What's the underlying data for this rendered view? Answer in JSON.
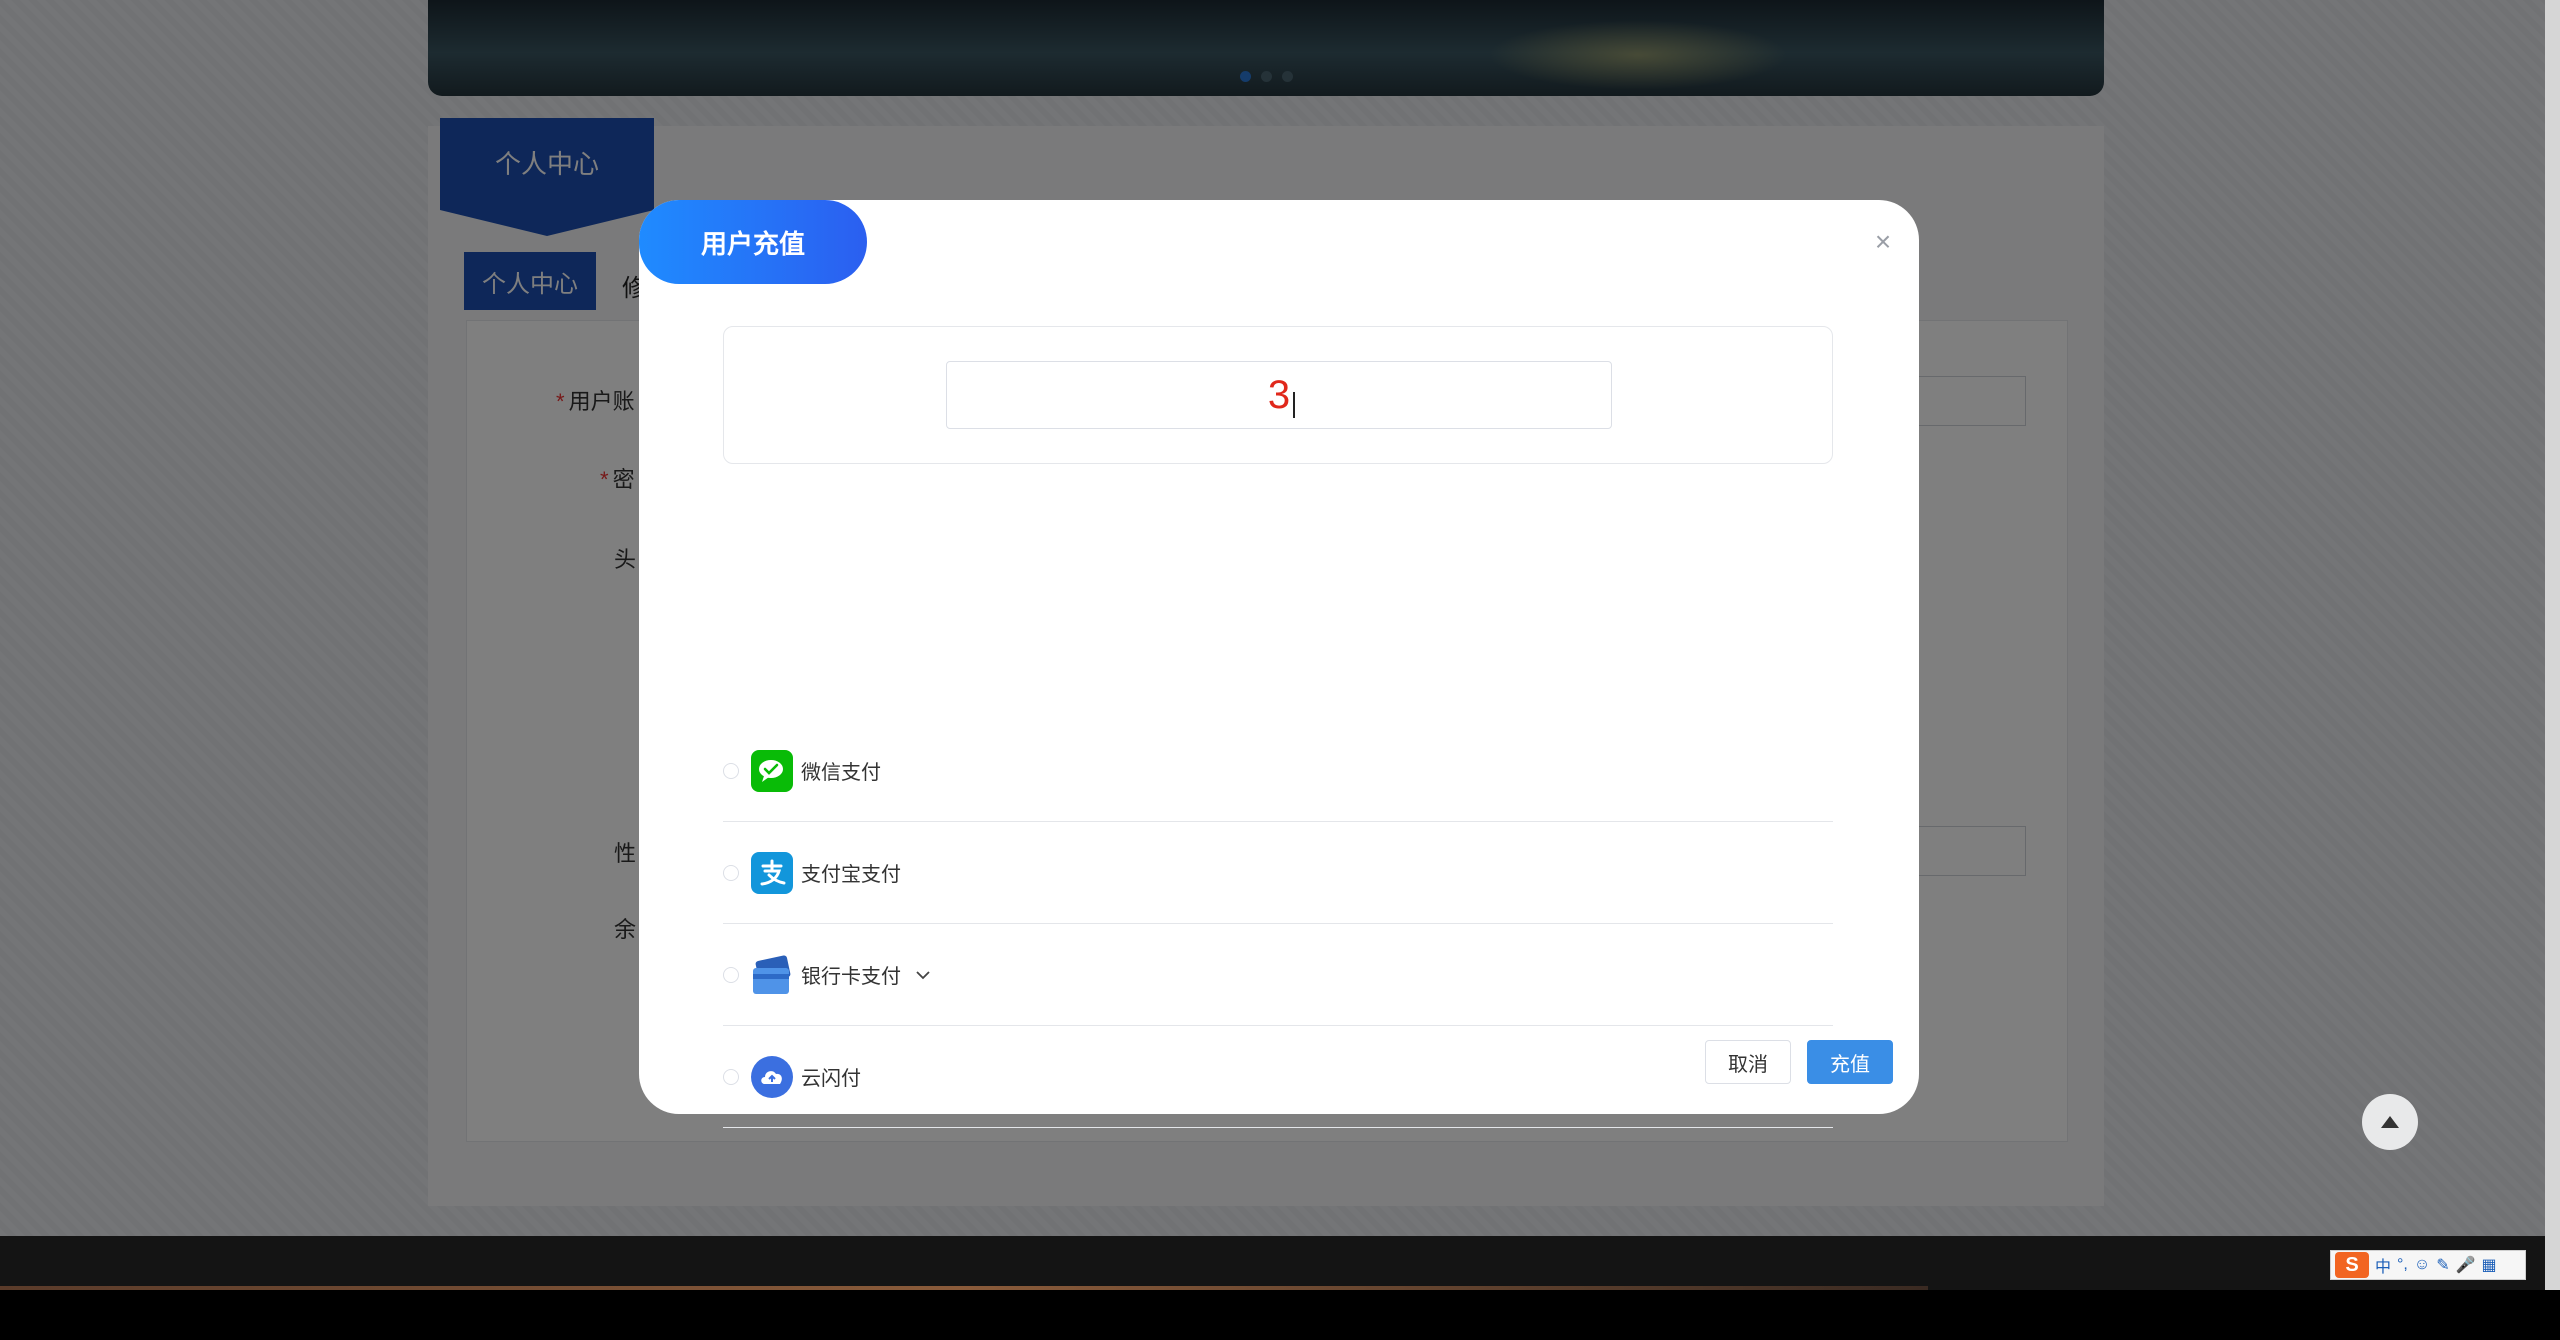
{
  "page": {
    "ribbon_title": "个人中心",
    "tabs": [
      {
        "label": "个人中心"
      },
      {
        "label": "修"
      }
    ],
    "form_labels": {
      "account": "用户账",
      "password": "密",
      "avatar": "头",
      "gender": "性",
      "balance": "余"
    }
  },
  "dialog": {
    "title": "用户充值",
    "close_icon": "close-icon",
    "amount_value": "3",
    "payment_options": [
      {
        "label": "微信支付",
        "icon": "wechat-pay-icon",
        "color": "#09bb07"
      },
      {
        "label": "支付宝支付",
        "icon": "alipay-icon",
        "color": "#1296db"
      },
      {
        "label": "银行卡支付",
        "icon": "bank-card-icon",
        "color": "#3f7fdd"
      },
      {
        "label": "云闪付",
        "icon": "unionpay-cloud-icon",
        "color": "#3b6fe0"
      }
    ],
    "cancel_label": "取消",
    "confirm_label": "充值"
  },
  "taskbar": {
    "ime_logo": "S",
    "ime_lang": "中"
  },
  "colors": {
    "brand_blue": "#1d4fb3",
    "dialog_title_gradient_start": "#1f8bff",
    "dialog_title_gradient_end": "#2b5ff0",
    "primary_button": "#3a8ee6",
    "amount_text": "#e0281b"
  }
}
